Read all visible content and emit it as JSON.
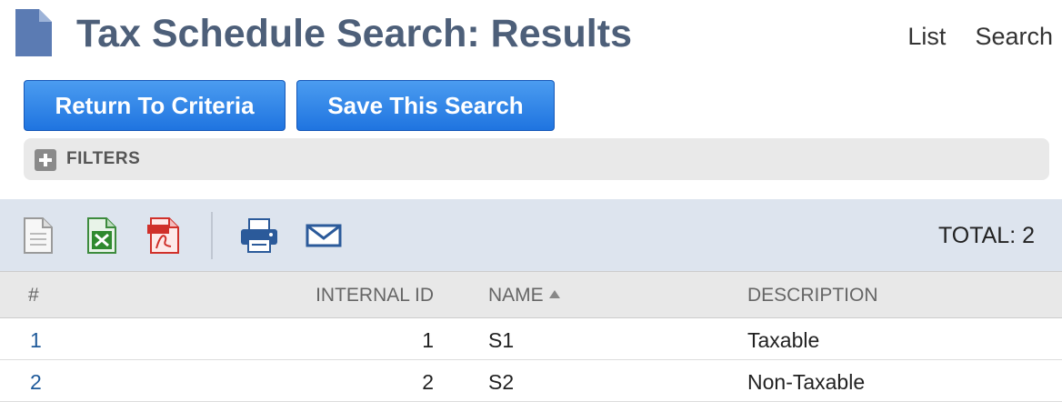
{
  "header": {
    "title": "Tax Schedule Search: Results",
    "nav": [
      "List",
      "Search"
    ]
  },
  "buttons": {
    "return_label": "Return To Criteria",
    "save_label": "Save This Search"
  },
  "filters": {
    "label": "FILTERS"
  },
  "toolbar": {
    "icons": [
      "export-csv-icon",
      "export-excel-icon",
      "export-pdf-icon",
      "print-icon",
      "email-icon"
    ],
    "total": "TOTAL: 2"
  },
  "table": {
    "columns": [
      "#",
      "INTERNAL ID",
      "NAME",
      "DESCRIPTION"
    ],
    "sorted_column": "NAME",
    "rows": [
      {
        "num": "1",
        "internal_id": "1",
        "name": "S1",
        "description": "Taxable"
      },
      {
        "num": "2",
        "internal_id": "2",
        "name": "S2",
        "description": "Non-Taxable"
      }
    ]
  },
  "colors": {
    "title": "#4d5f79",
    "button": "#2a7ee6",
    "toolbar_bg": "#dde4ee",
    "link": "#1f5a9a"
  }
}
